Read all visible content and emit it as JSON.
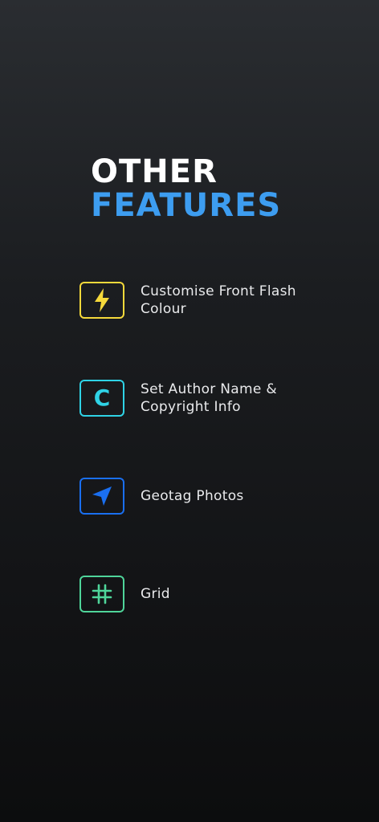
{
  "heading": {
    "line1": "OTHER",
    "line2": "FEATURES"
  },
  "colors": {
    "accent_blue": "#3d9df0",
    "flash": "#f5d93b",
    "author": "#2fd3e6",
    "geotag": "#1a6ff0",
    "grid": "#4fd59a"
  },
  "features": [
    {
      "icon": "lightning-icon",
      "label": "Customise Front Flash\nColour"
    },
    {
      "icon": "letter-c-icon",
      "icon_text": "C",
      "label": "Set Author Name &\nCopyright Info"
    },
    {
      "icon": "location-arrow-icon",
      "label": "Geotag Photos"
    },
    {
      "icon": "grid-hash-icon",
      "label": "Grid"
    }
  ]
}
